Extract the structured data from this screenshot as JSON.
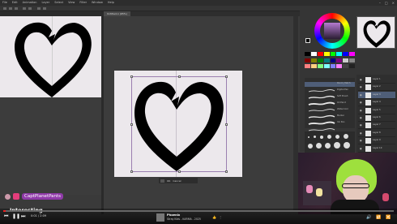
{
  "menu": {
    "items": [
      "File",
      "Edit",
      "Animation",
      "Layer",
      "Select",
      "View",
      "Filter",
      "Window",
      "Help"
    ]
  },
  "document": {
    "tab_label": "Untitled-1 (65%)"
  },
  "transform": {
    "ok_label": "OK",
    "cancel_label": "Cancel"
  },
  "colors": {
    "swatches": [
      "#000000",
      "#ffffff",
      "#ff0000",
      "#ffff00",
      "#00ff00",
      "#00ffff",
      "#0000ff",
      "#ff00ff",
      "#7f0000",
      "#7f7f00",
      "#007f00",
      "#007f7f",
      "#00007f",
      "#7f007f",
      "#cccccc",
      "#888888",
      "#ff8080",
      "#ffd080",
      "#80ff80",
      "#80ffff",
      "#8080ff",
      "#ff80ff",
      "#444444",
      "#222222"
    ]
  },
  "brushes": [
    {
      "label": "Pencil_Hatch"
    },
    {
      "label": "Digital Pen"
    },
    {
      "label": "Soft Brush"
    },
    {
      "label": "Oil Paint"
    },
    {
      "label": "Watercolor"
    },
    {
      "label": "Marker"
    },
    {
      "label": "Ink Pen"
    }
  ],
  "layers": [
    {
      "name": "Layer 1"
    },
    {
      "name": "Layer 2"
    },
    {
      "name": "Layer 3"
    },
    {
      "name": "Layer 4"
    },
    {
      "name": "Layer 5"
    },
    {
      "name": "Layer 6"
    },
    {
      "name": "Layer 7"
    },
    {
      "name": "Layer 8"
    },
    {
      "name": "Layer 9"
    },
    {
      "name": "Layer 10"
    }
  ],
  "chat": {
    "username": "CaptPlanetPants",
    "message": "Interesting"
  },
  "player": {
    "time": "0:01 / 2:09",
    "track_title": "Phoenix",
    "track_subtitle": "Stray Kids - KARMA - 2025"
  },
  "accent": {
    "chat_pill": "#8f3aa8",
    "progress": "#ee2222"
  }
}
